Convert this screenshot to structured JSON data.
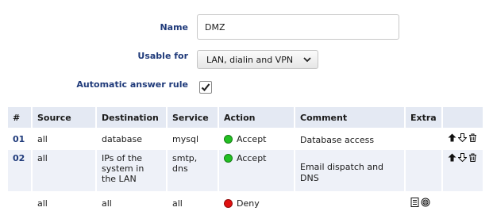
{
  "form": {
    "name_label": "Name",
    "name_value": "DMZ",
    "usable_label": "Usable for",
    "usable_value": "LAN, dialin and VPN",
    "auto_label": "Automatic answer rule",
    "auto_checked": true
  },
  "table": {
    "headers": [
      "#",
      "Source",
      "Destination",
      "Service",
      "Action",
      "Comment",
      "Extra"
    ],
    "rows": [
      {
        "num": "01",
        "source": "all",
        "destination": "database",
        "service": "mysql",
        "action": "Accept",
        "action_color": "#22c022",
        "comment": "Database access"
      },
      {
        "num": "02",
        "source": "all",
        "destination": "IPs of the system in the LAN",
        "service": "smtp, dns",
        "action": "Accept",
        "action_color": "#22c022",
        "comment": "Email dispatch and DNS"
      },
      {
        "num": "",
        "source": "all",
        "destination": "all",
        "service": "all",
        "action": "Deny",
        "action_color": "#e01010",
        "comment": ""
      }
    ]
  },
  "icons": {
    "move_up": "arrow-up-icon",
    "move_down": "arrow-down-icon",
    "delete": "trash-icon",
    "log": "log-icon",
    "settings": "settings-icon"
  }
}
